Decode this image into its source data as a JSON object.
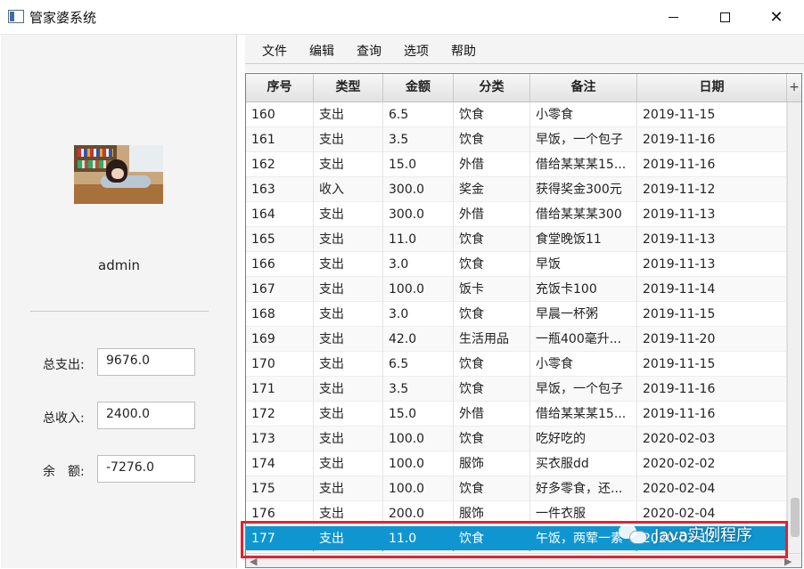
{
  "window": {
    "title": "管家婆系统",
    "minimize_icon": "minimize-icon",
    "maximize_icon": "maximize-icon",
    "close_glyph": "✕"
  },
  "sidebar": {
    "username": "admin",
    "stats": [
      {
        "label": "总支出:",
        "value": "9676.0"
      },
      {
        "label": "总收入:",
        "value": "2400.0"
      },
      {
        "label": "余　额:",
        "value": "-7276.0"
      }
    ]
  },
  "menu": [
    "文件",
    "编辑",
    "查询",
    "选项",
    "帮助"
  ],
  "table": {
    "columns": [
      "序号",
      "类型",
      "金额",
      "分类",
      "备注",
      "日期"
    ],
    "add_column_glyph": "+",
    "rows": [
      [
        "160",
        "支出",
        "6.5",
        "饮食",
        "小零食",
        "2019-11-15"
      ],
      [
        "161",
        "支出",
        "3.5",
        "饮食",
        "早饭，一个包子",
        "2019-11-16"
      ],
      [
        "162",
        "支出",
        "15.0",
        "外借",
        "借给某某某15...",
        "2019-11-16"
      ],
      [
        "163",
        "收入",
        "300.0",
        "奖金",
        "获得奖金300元",
        "2019-11-12"
      ],
      [
        "164",
        "支出",
        "300.0",
        "外借",
        "借给某某某300",
        "2019-11-13"
      ],
      [
        "165",
        "支出",
        "11.0",
        "饮食",
        "食堂晚饭11",
        "2019-11-13"
      ],
      [
        "166",
        "支出",
        "3.0",
        "饮食",
        "早饭",
        "2019-11-13"
      ],
      [
        "167",
        "支出",
        "100.0",
        "饭卡",
        "充饭卡100",
        "2019-11-14"
      ],
      [
        "168",
        "支出",
        "3.0",
        "饮食",
        "早晨一杯粥",
        "2019-11-15"
      ],
      [
        "169",
        "支出",
        "42.0",
        "生活用品",
        "一瓶400毫升...",
        "2019-11-20"
      ],
      [
        "170",
        "支出",
        "6.5",
        "饮食",
        "小零食",
        "2019-11-15"
      ],
      [
        "171",
        "支出",
        "3.5",
        "饮食",
        "早饭，一个包子",
        "2019-11-16"
      ],
      [
        "172",
        "支出",
        "15.0",
        "外借",
        "借给某某某15...",
        "2019-11-16"
      ],
      [
        "173",
        "支出",
        "100.0",
        "饮食",
        "吃好吃的",
        "2020-02-03"
      ],
      [
        "174",
        "支出",
        "100.0",
        "服饰",
        "买衣服dd",
        "2020-02-02"
      ],
      [
        "175",
        "支出",
        "100.0",
        "饮食",
        "好多零食，还...",
        "2020-02-04"
      ],
      [
        "176",
        "支出",
        "200.0",
        "服饰",
        "一件衣服",
        "2020-02-04"
      ],
      [
        "177",
        "支出",
        "11.0",
        "饮食",
        "午饭，两荤一素",
        "2020-02-12"
      ]
    ],
    "selected_row_index": 17
  },
  "watermark": "Java实例程序",
  "colors": {
    "selection": "#0f96d0",
    "highlight_border": "#e0242f",
    "table_border": "#3f91c8"
  }
}
